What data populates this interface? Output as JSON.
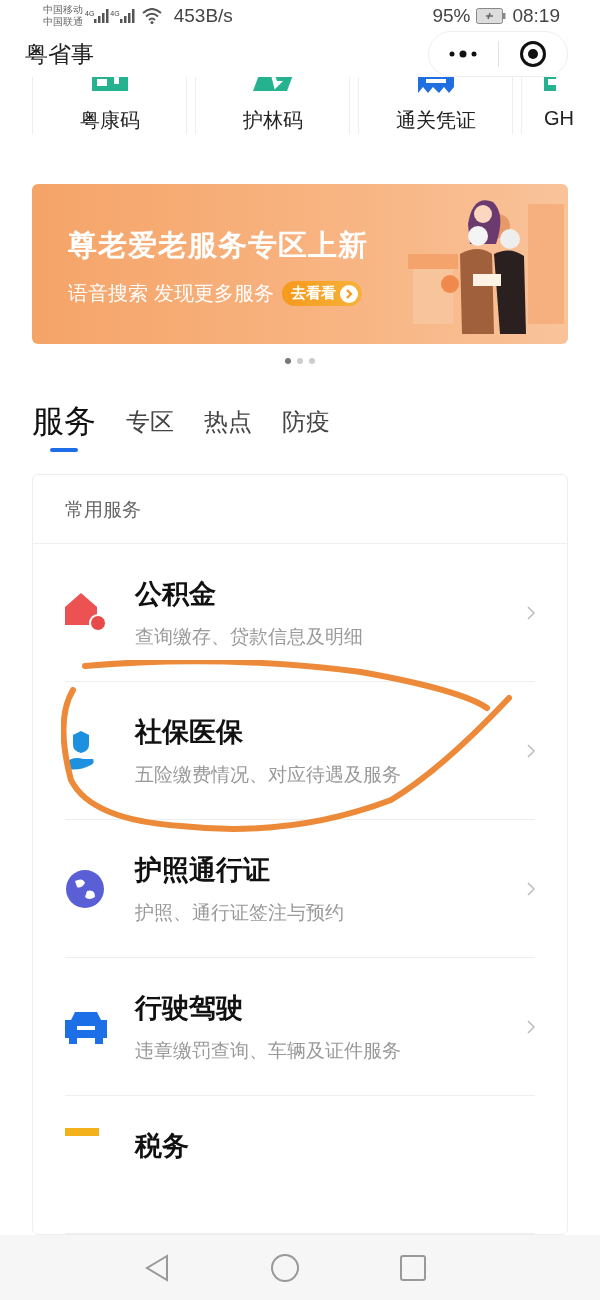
{
  "status_bar": {
    "carriers": [
      "中国移动",
      "中国联通"
    ],
    "network_types": [
      "4G",
      "4G"
    ],
    "speed": "453B/s",
    "battery": "95%",
    "time": "08:19"
  },
  "header": {
    "title": "粤省事"
  },
  "quick_tiles": [
    {
      "label": "粤康码",
      "kind": "health-code"
    },
    {
      "label": "护林码",
      "kind": "forest-code"
    },
    {
      "label": "通关凭证",
      "kind": "customs"
    },
    {
      "label": "GH",
      "kind": "partial"
    }
  ],
  "banner": {
    "title": "尊老爱老服务专区上新",
    "subtitle": "语音搜索 发现更多服务",
    "button": "去看看",
    "dots": [
      {
        "selected": true
      },
      {
        "selected": false
      },
      {
        "selected": false
      }
    ]
  },
  "tabs": [
    {
      "label": "服务",
      "selected": true
    },
    {
      "label": "专区",
      "selected": false
    },
    {
      "label": "热点",
      "selected": false
    },
    {
      "label": "防疫",
      "selected": false
    }
  ],
  "services": {
    "heading": "常用服务",
    "items": [
      {
        "kind": "housing",
        "title": "公积金",
        "subtitle": "查询缴存、贷款信息及明细",
        "circled": false
      },
      {
        "kind": "social-security",
        "title": "社保医保",
        "subtitle": "五险缴费情况、对应待遇及服务",
        "circled": true
      },
      {
        "kind": "passport",
        "title": "护照通行证",
        "subtitle": "护照、通行证签注与预约",
        "circled": false
      },
      {
        "kind": "vehicle",
        "title": "行驶驾驶",
        "subtitle": "违章缴罚查询、车辆及证件服务",
        "circled": false
      },
      {
        "kind": "tax",
        "title": "税务",
        "circled": false
      }
    ]
  }
}
